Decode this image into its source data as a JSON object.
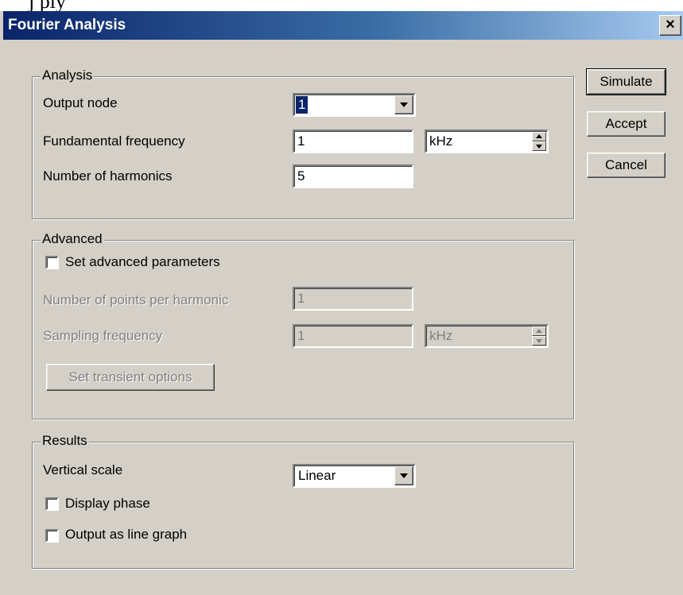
{
  "window": {
    "title": "Fourier Analysis",
    "close_label": "×"
  },
  "top_strip_text": "j                          ply",
  "analysis": {
    "legend": "Analysis",
    "output_node": {
      "label": "Output node",
      "value": "1"
    },
    "fundamental_frequency": {
      "label": "Fundamental frequency",
      "value": "1",
      "unit": "kHz"
    },
    "harmonics": {
      "label": "Number of harmonics",
      "value": "5"
    }
  },
  "advanced": {
    "legend": "Advanced",
    "set_params": {
      "label": "Set advanced parameters",
      "checked": false
    },
    "points_per_harmonic": {
      "label": "Number of points per harmonic",
      "value": "1"
    },
    "sampling_frequency": {
      "label": "Sampling frequency",
      "value": "1",
      "unit": "kHz"
    },
    "transient_button": "Set transient options"
  },
  "results": {
    "legend": "Results",
    "vertical_scale": {
      "label": "Vertical scale",
      "value": "Linear"
    },
    "display_phase": {
      "label": "Display phase",
      "checked": false
    },
    "line_graph": {
      "label": "Output as line graph",
      "checked": false
    }
  },
  "buttons": {
    "simulate": "Simulate",
    "accept": "Accept",
    "cancel": "Cancel"
  }
}
